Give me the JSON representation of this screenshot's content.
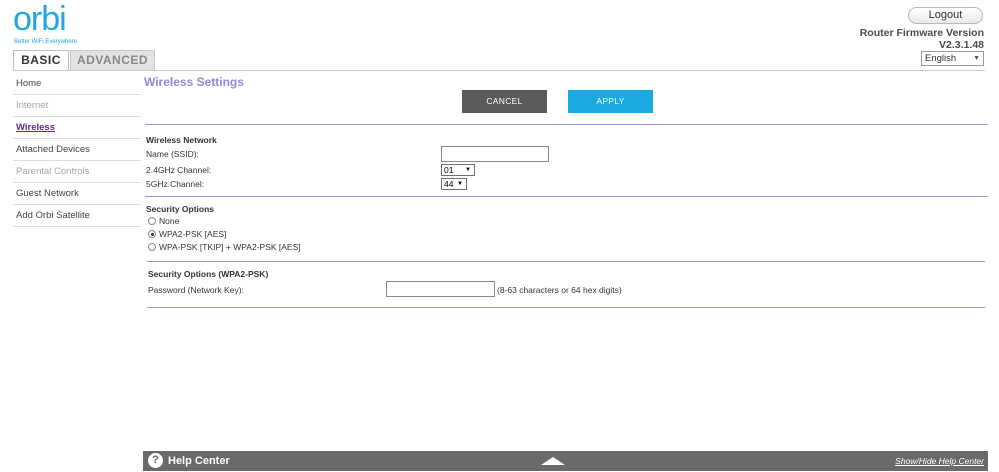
{
  "brand": {
    "logo_text": "orbi",
    "tagline": "Better WiFi Everywhere",
    "color": "#24a5e0"
  },
  "header": {
    "logout_label": "Logout",
    "firmware_label": "Router Firmware Version",
    "firmware_version": "V2.3.1.48",
    "language": "English"
  },
  "tabs": [
    {
      "label": "BASIC",
      "active": true
    },
    {
      "label": "ADVANCED",
      "active": false
    }
  ],
  "sidebar": {
    "items": [
      {
        "label": "Home",
        "state": "normal"
      },
      {
        "label": "Internet",
        "state": "disabled"
      },
      {
        "label": "Wireless",
        "state": "active"
      },
      {
        "label": "Attached Devices",
        "state": "normal"
      },
      {
        "label": "Parental Controls",
        "state": "disabled"
      },
      {
        "label": "Guest Network",
        "state": "normal"
      },
      {
        "label": "Add Orbi Satellite",
        "state": "normal"
      }
    ]
  },
  "main": {
    "title": "Wireless Settings",
    "cancel_label": "CANCEL",
    "apply_label": "APPLY",
    "wireless_network": {
      "title": "Wireless Network",
      "ssid_label": "Name (SSID):",
      "ssid_value": "",
      "ch24_label": "2.4GHz Channel:",
      "ch24_value": "01",
      "ch5_label": "5GHz Channel:",
      "ch5_value": "44"
    },
    "security": {
      "title": "Security Options",
      "options": [
        {
          "label": "None",
          "checked": false
        },
        {
          "label": "WPA2-PSK [AES]",
          "checked": true
        },
        {
          "label": "WPA-PSK [TKIP] + WPA2-PSK [AES]",
          "checked": false
        }
      ]
    },
    "wpa2": {
      "title": "Security Options (WPA2-PSK)",
      "password_label": "Password (Network Key):",
      "password_value": "",
      "hint": "(8-63 characters or 64 hex digits)"
    }
  },
  "help": {
    "icon": "question-icon",
    "title": "Help Center",
    "toggle_label": "Show/Hide Help Center"
  },
  "colors": {
    "accent": "#8e8ad8",
    "apply": "#1aa9e0",
    "cancel": "#5a5a5a",
    "active_nav": "#6a2a85",
    "help_bar": "#6a6a6a"
  }
}
